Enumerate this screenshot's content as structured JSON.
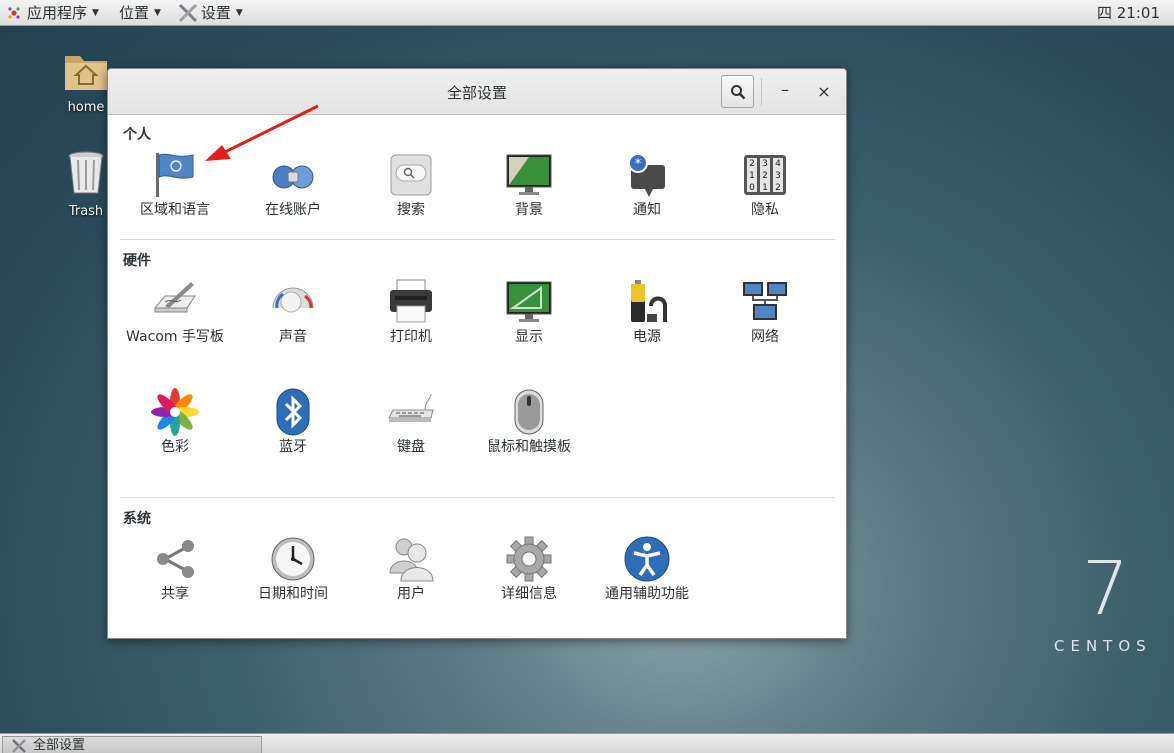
{
  "top_panel": {
    "apps_menu": "应用程序",
    "places_menu": "位置",
    "settings_menu": "设置",
    "clock": "四 21:01"
  },
  "desktop": {
    "icons": [
      {
        "label": "home",
        "icon": "home-folder-icon"
      },
      {
        "label": "Trash",
        "icon": "trash-icon"
      }
    ],
    "brand_number": "7",
    "brand_word": "CENTOS"
  },
  "window": {
    "title": "全部设置",
    "search_icon": "search-icon",
    "minimize": "–",
    "close": "×"
  },
  "sections": {
    "personal": {
      "title": "个人",
      "items": [
        {
          "label": "区域和语言",
          "icon": "flag-icon"
        },
        {
          "label": "在线账户",
          "icon": "online-accounts-icon"
        },
        {
          "label": "搜索",
          "icon": "search-settings-icon"
        },
        {
          "label": "背景",
          "icon": "background-icon"
        },
        {
          "label": "通知",
          "icon": "notification-icon"
        },
        {
          "label": "隐私",
          "icon": "privacy-lock-icon"
        }
      ]
    },
    "hardware": {
      "title": "硬件",
      "items": [
        {
          "label": "Wacom 手写板",
          "icon": "wacom-tablet-icon"
        },
        {
          "label": "声音",
          "icon": "sound-icon"
        },
        {
          "label": "打印机",
          "icon": "printer-icon"
        },
        {
          "label": "显示",
          "icon": "display-icon"
        },
        {
          "label": "电源",
          "icon": "power-battery-icon"
        },
        {
          "label": "网络",
          "icon": "network-icon"
        },
        {
          "label": "色彩",
          "icon": "color-icon"
        },
        {
          "label": "蓝牙",
          "icon": "bluetooth-icon"
        },
        {
          "label": "键盘",
          "icon": "keyboard-icon"
        },
        {
          "label": "鼠标和触摸板",
          "icon": "mouse-icon"
        }
      ]
    },
    "system": {
      "title": "系统",
      "items": [
        {
          "label": "共享",
          "icon": "share-icon"
        },
        {
          "label": "日期和时间",
          "icon": "clock-icon"
        },
        {
          "label": "用户",
          "icon": "users-icon"
        },
        {
          "label": "详细信息",
          "icon": "gear-details-icon"
        },
        {
          "label": "通用辅助功能",
          "icon": "accessibility-icon"
        }
      ]
    }
  },
  "taskbar": {
    "task_label": "全部设置"
  },
  "colors": {
    "annotation_arrow": "#e0201b",
    "accent_blue": "#3b6fbf"
  }
}
